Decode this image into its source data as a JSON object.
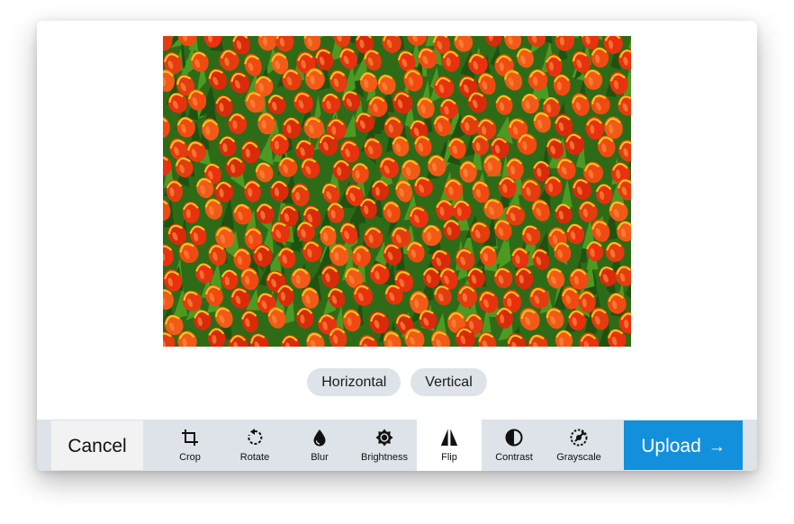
{
  "preview": {
    "image_alt": "tulip field photo"
  },
  "flip_options": [
    {
      "label": "Horizontal"
    },
    {
      "label": "Vertical"
    }
  ],
  "toolbar": {
    "cancel_label": "Cancel",
    "upload_label": "Upload",
    "upload_arrow_icon": "arrow-right-icon",
    "active_tool": "Flip",
    "tools": [
      {
        "label": "Crop",
        "icon": "crop-icon"
      },
      {
        "label": "Rotate",
        "icon": "rotate-icon"
      },
      {
        "label": "Blur",
        "icon": "droplet-icon"
      },
      {
        "label": "Brightness",
        "icon": "sun-icon"
      },
      {
        "label": "Flip",
        "icon": "flip-icon"
      },
      {
        "label": "Contrast",
        "icon": "contrast-icon"
      },
      {
        "label": "Grayscale",
        "icon": "grayscale-icon"
      }
    ]
  },
  "colors": {
    "toolbar_bg": "#dde3e8",
    "upload_bg": "#1390dc",
    "pill_bg": "#dde3e8",
    "active_tool_bg": "#ffffff"
  }
}
